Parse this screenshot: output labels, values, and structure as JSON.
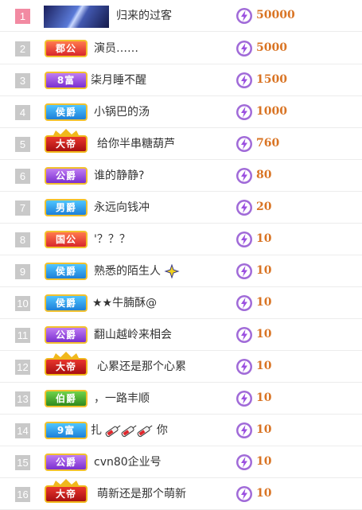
{
  "colors": {
    "score": "#d97424",
    "rank_first": "#f28aa2",
    "rank_other": "#c9c9c9"
  },
  "rows": [
    {
      "rank": "1",
      "badge": "",
      "badge_style": "avatar",
      "name": "归来的过客",
      "score": "50000"
    },
    {
      "rank": "2",
      "badge": "郡公",
      "badge_style": "red",
      "name": "演员……",
      "score": "5000"
    },
    {
      "rank": "3",
      "badge": "8富",
      "badge_style": "purple",
      "name": "柒月睡不醒",
      "score": "1500"
    },
    {
      "rank": "4",
      "badge": "侯爵",
      "badge_style": "blue",
      "name": "小锅巴的汤",
      "score": "1000"
    },
    {
      "rank": "5",
      "badge": "大帝",
      "badge_style": "emperor",
      "name": "给你半串糖葫芦",
      "score": "760"
    },
    {
      "rank": "6",
      "badge": "公爵",
      "badge_style": "purple",
      "name": "谁的静静?",
      "score": "80"
    },
    {
      "rank": "7",
      "badge": "男爵",
      "badge_style": "blue",
      "name": "永远向钱冲",
      "score": "20"
    },
    {
      "rank": "8",
      "badge": "国公",
      "badge_style": "red",
      "name": "'？？？",
      "score": "10"
    },
    {
      "rank": "9",
      "badge": "侯爵",
      "badge_style": "blue",
      "name": "熟悉的陌生人",
      "score": "10"
    },
    {
      "rank": "10",
      "badge": "侯爵",
      "badge_style": "blue",
      "name": "★★牛腩酥@",
      "score": "10"
    },
    {
      "rank": "11",
      "badge": "公爵",
      "badge_style": "purple",
      "name": "翻山越岭来相会",
      "score": "10"
    },
    {
      "rank": "12",
      "badge": "大帝",
      "badge_style": "emperor",
      "name": "心累还是那个心累",
      "score": "10"
    },
    {
      "rank": "13",
      "badge": "伯爵",
      "badge_style": "green",
      "name": "，一路丰顺",
      "score": "10"
    },
    {
      "rank": "14",
      "badge": "9富",
      "badge_style": "blue",
      "name": "扎",
      "name_suffix": "你",
      "score": "10"
    },
    {
      "rank": "15",
      "badge": "公爵",
      "badge_style": "purple",
      "name": "cvn80企业号",
      "score": "10"
    },
    {
      "rank": "16",
      "badge": "大帝",
      "badge_style": "emperor",
      "name": "萌新还是那个萌新",
      "score": "10"
    }
  ]
}
